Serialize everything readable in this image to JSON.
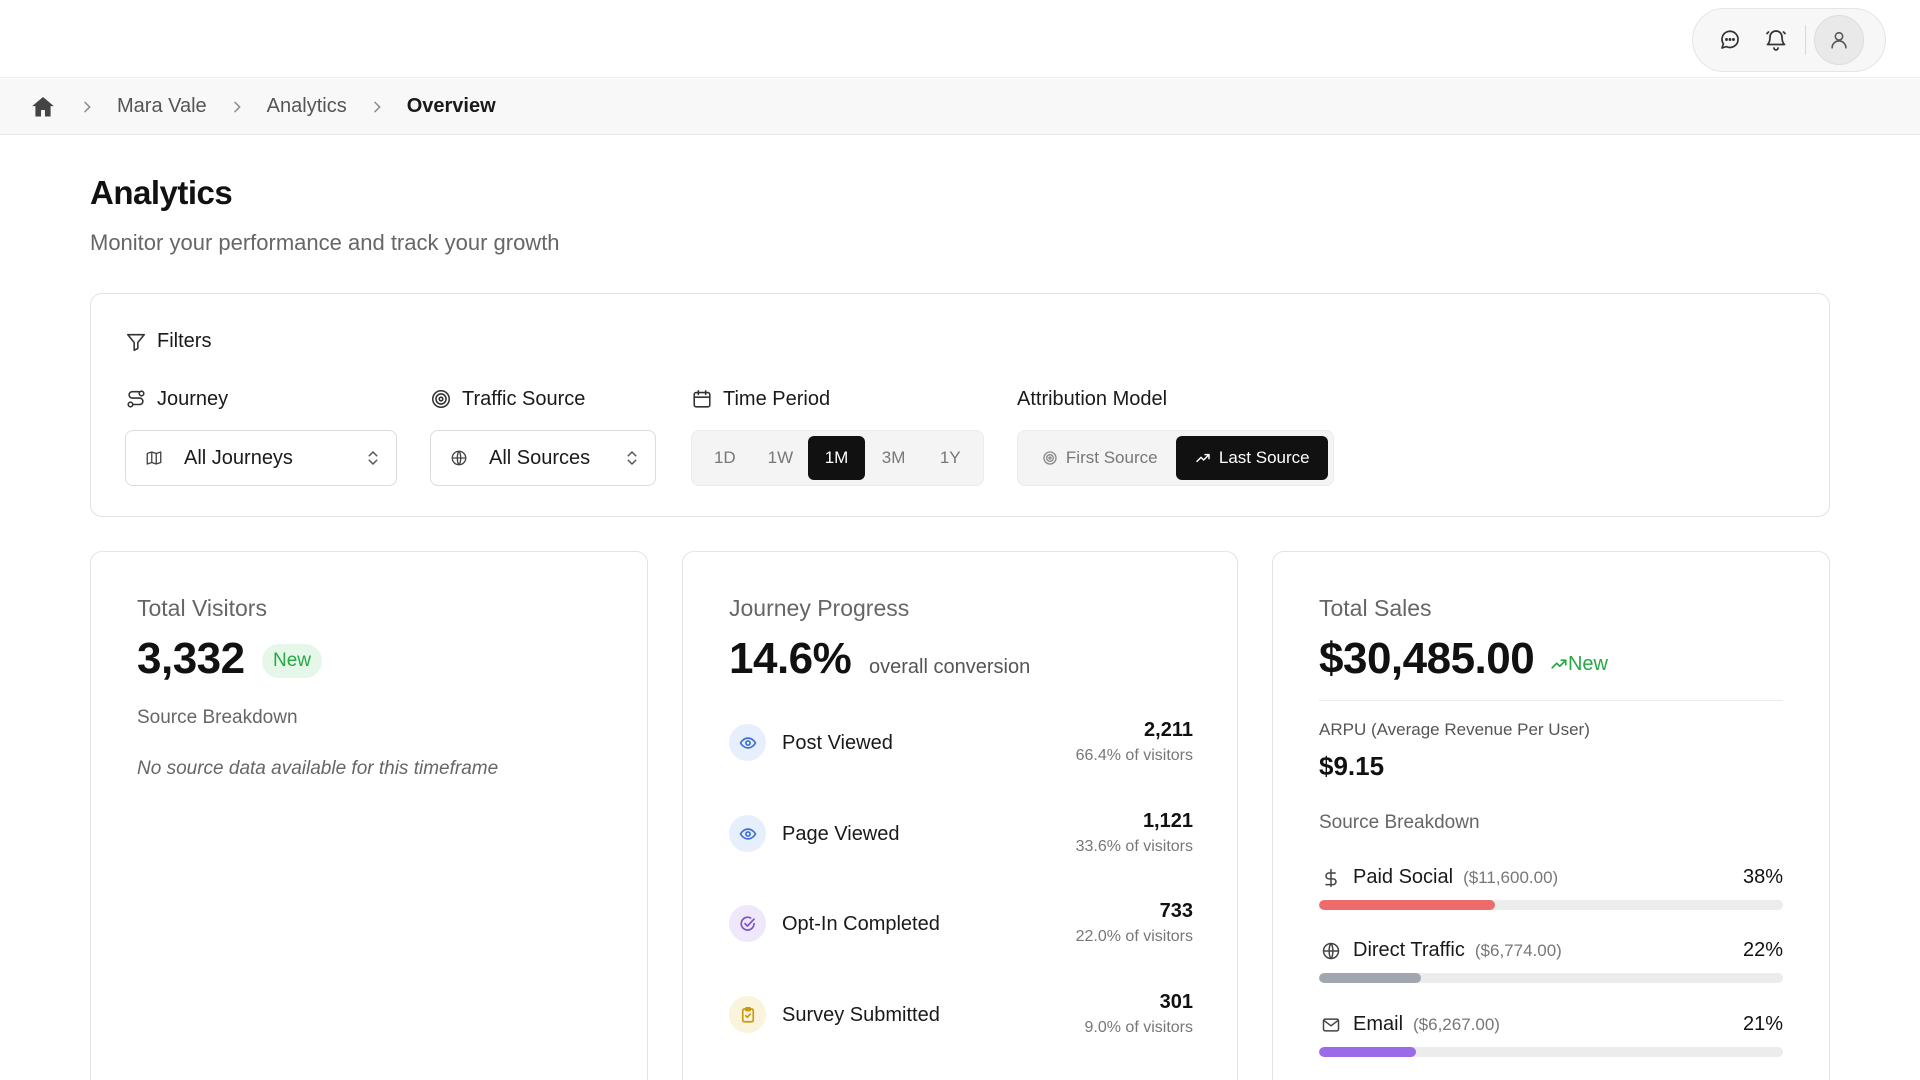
{
  "breadcrumb": {
    "items": [
      "Mara Vale",
      "Analytics",
      "Overview"
    ]
  },
  "page": {
    "title": "Analytics",
    "subtitle": "Monitor your performance and track your growth"
  },
  "filters": {
    "heading": "Filters",
    "journey": {
      "label": "Journey",
      "value": "All Journeys"
    },
    "traffic_source": {
      "label": "Traffic Source",
      "value": "All Sources"
    },
    "time_period": {
      "label": "Time Period",
      "options": [
        "1D",
        "1W",
        "1M",
        "3M",
        "1Y"
      ],
      "selected": "1M"
    },
    "attribution": {
      "label": "Attribution Model",
      "options": [
        "First Source",
        "Last Source"
      ],
      "selected": "Last Source"
    }
  },
  "visitors": {
    "title": "Total Visitors",
    "value": "3,332",
    "badge": "New",
    "breakdown_label": "Source Breakdown",
    "empty_note": "No source data available for this timeframe"
  },
  "journey": {
    "title": "Journey Progress",
    "value": "14.6%",
    "value_suffix": "overall conversion",
    "steps": [
      {
        "label": "Post Viewed",
        "count": "2,211",
        "pct": "66.4% of visitors",
        "icon": "eye-icon",
        "color": "#3b6fd8",
        "bg": "#e8effc"
      },
      {
        "label": "Page Viewed",
        "count": "1,121",
        "pct": "33.6% of visitors",
        "icon": "eye-icon",
        "color": "#3b6fd8",
        "bg": "#e8effc"
      },
      {
        "label": "Opt-In Completed",
        "count": "733",
        "pct": "22.0% of visitors",
        "icon": "check-circle-icon",
        "color": "#7b4fd0",
        "bg": "#efe8fb"
      },
      {
        "label": "Survey Submitted",
        "count": "301",
        "pct": "9.0% of visitors",
        "icon": "clipboard-icon",
        "color": "#c89a10",
        "bg": "#fbf4dc"
      }
    ]
  },
  "sales": {
    "title": "Total Sales",
    "value": "$30,485.00",
    "badge": "New",
    "arpu_label": "ARPU (Average Revenue Per User)",
    "arpu_value": "$9.15",
    "breakdown_label": "Source Breakdown",
    "sources": [
      {
        "name": "Paid Social",
        "amount": "($11,600.00)",
        "pct": "38%",
        "share": 0.38,
        "icon": "dollar-icon",
        "color": "#ee6b6b"
      },
      {
        "name": "Direct Traffic",
        "amount": "($6,774.00)",
        "pct": "22%",
        "share": 0.22,
        "icon": "globe-icon",
        "color": "#a2a6ae"
      },
      {
        "name": "Email",
        "amount": "($6,267.00)",
        "pct": "21%",
        "share": 0.21,
        "icon": "mail-icon",
        "color": "#9b6ae8"
      }
    ]
  }
}
